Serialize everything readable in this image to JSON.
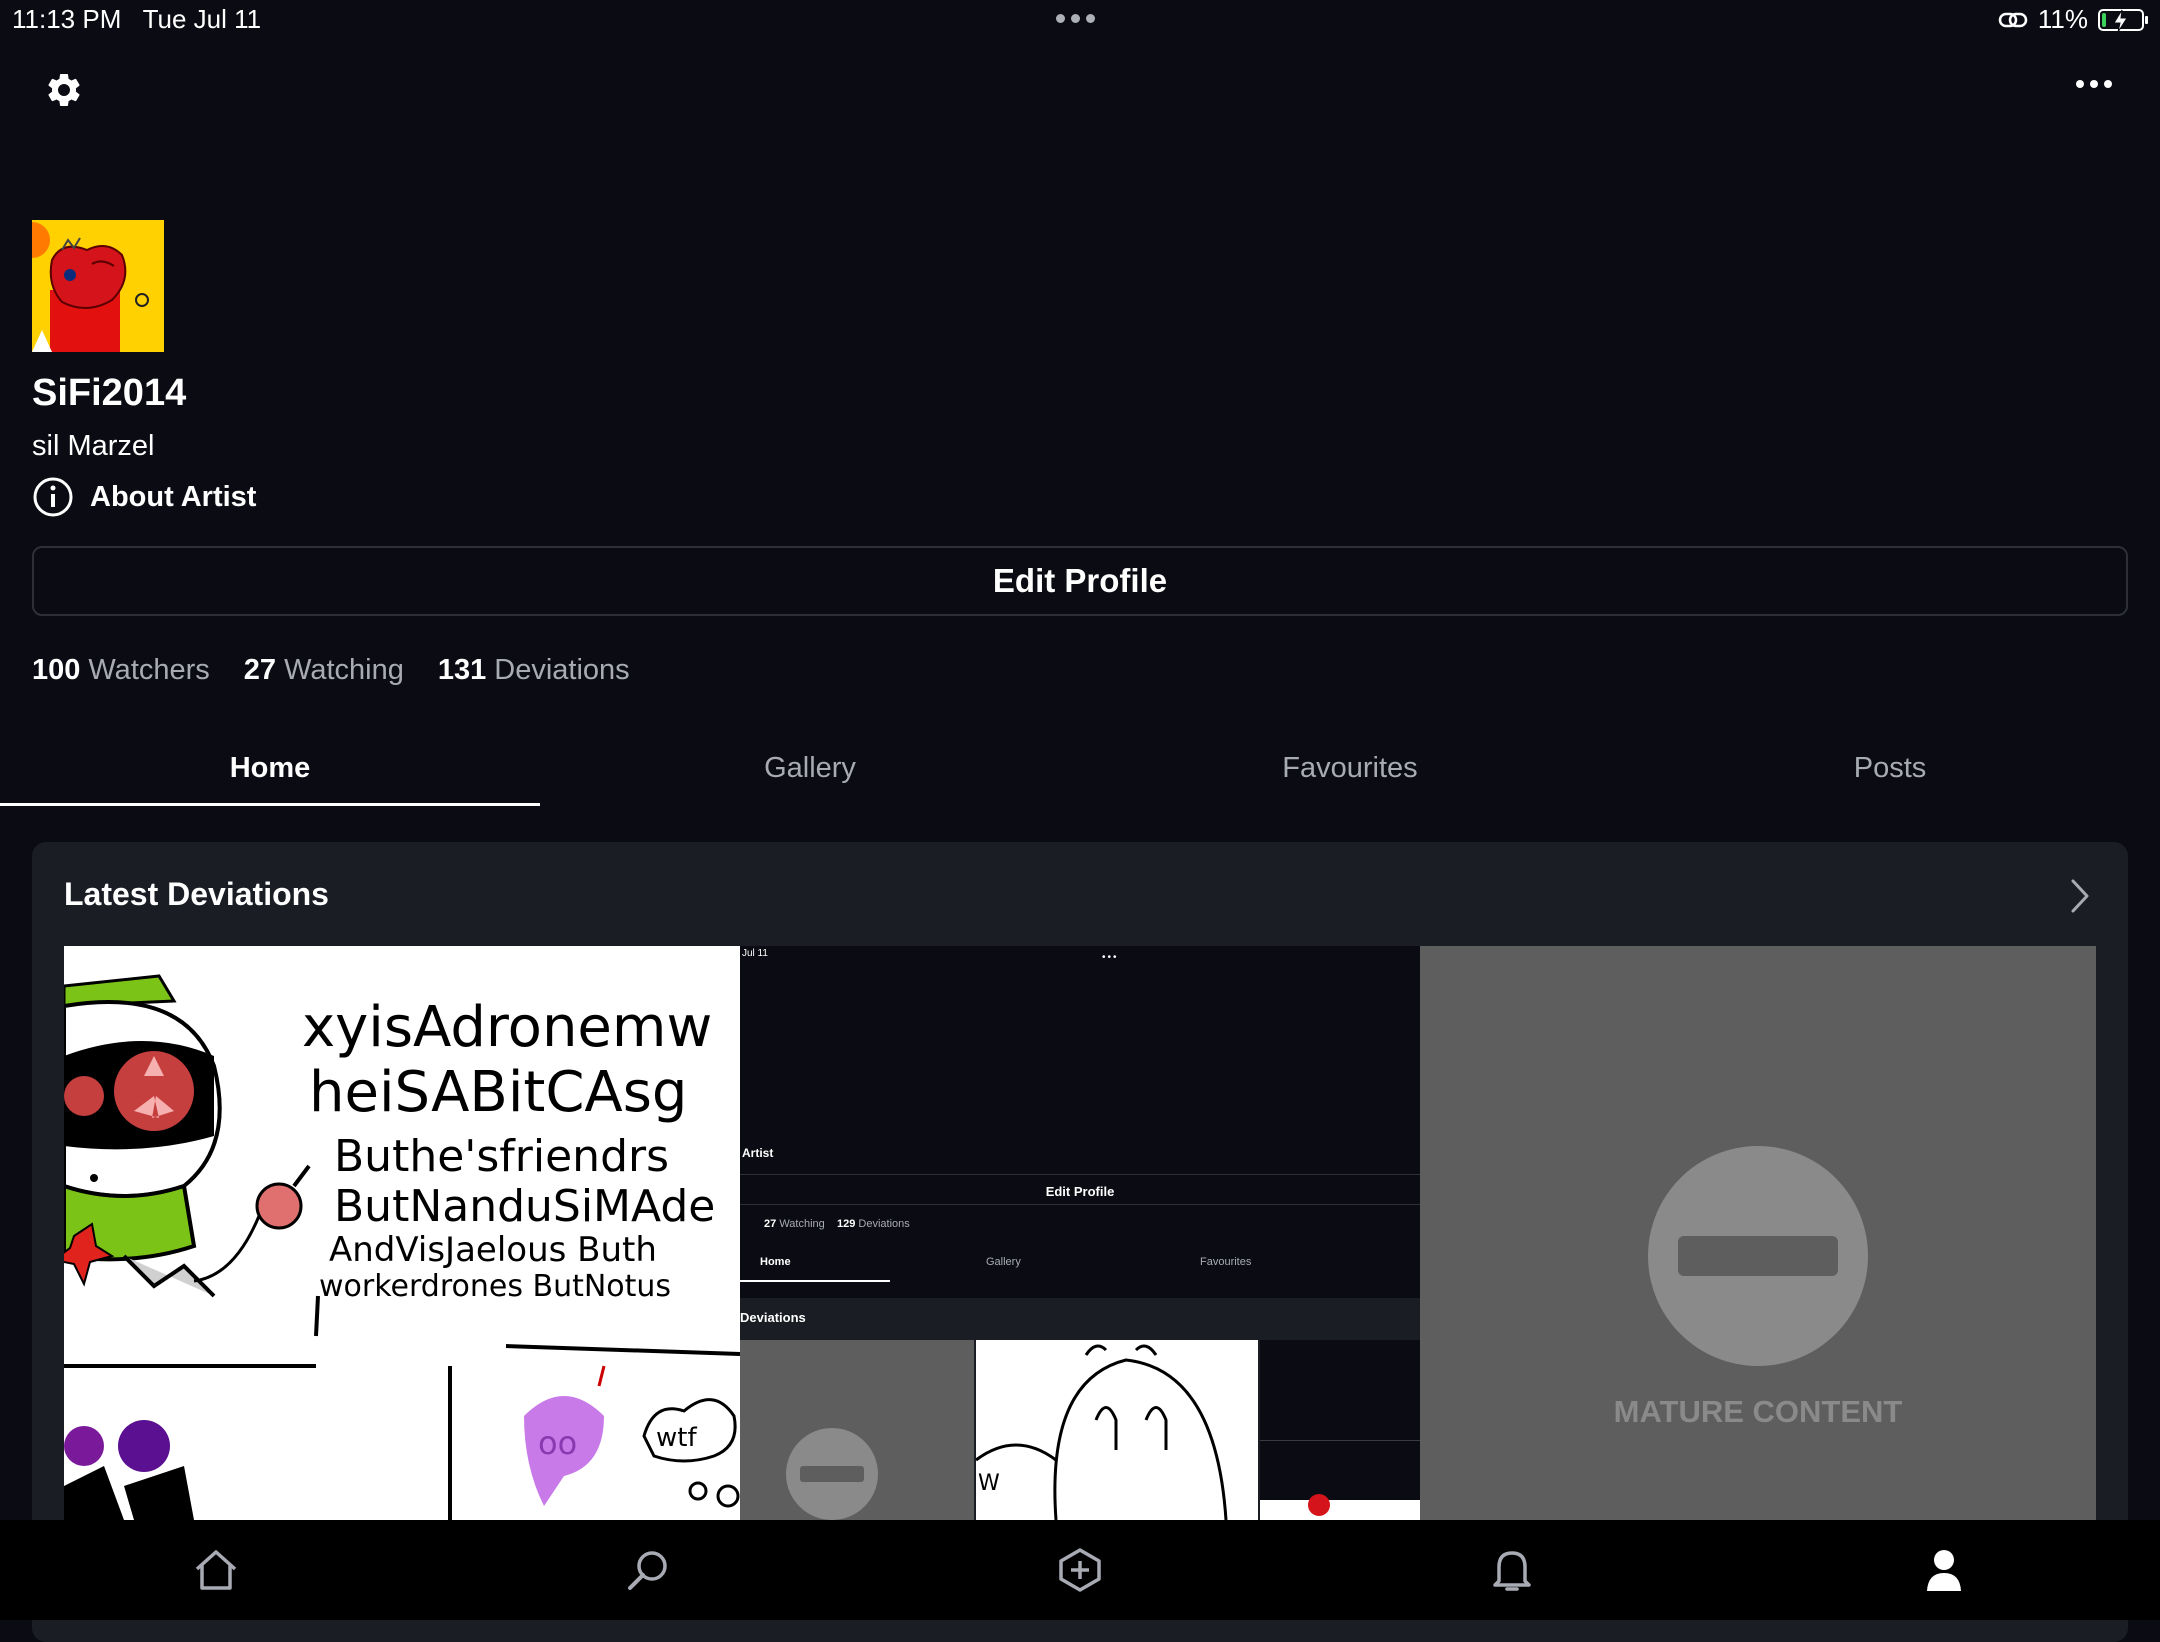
{
  "status_bar": {
    "time": "11:13 PM",
    "date": "Tue Jul 11",
    "battery": "11%",
    "battery_level_percent": 11,
    "icons": [
      "link-icon",
      "battery-charging-icon"
    ]
  },
  "header": {
    "settings_icon": "gear-icon",
    "more_icon": "more-horizontal-icon"
  },
  "profile": {
    "username": "SiFi2014",
    "real_name": "sil Marzel",
    "about_label": "About Artist",
    "edit_label": "Edit Profile"
  },
  "stats": [
    {
      "value": "100",
      "label": "Watchers"
    },
    {
      "value": "27",
      "label": "Watching"
    },
    {
      "value": "131",
      "label": "Deviations"
    }
  ],
  "tabs": [
    {
      "label": "Home",
      "active": true
    },
    {
      "label": "Gallery",
      "active": false
    },
    {
      "label": "Favourites",
      "active": false
    },
    {
      "label": "Posts",
      "active": false
    }
  ],
  "latest": {
    "title": "Latest Deviations",
    "thumb1": {
      "lines": [
        "xyisAdronemw",
        "heiSABitCAsg",
        "Buthe'sfriendrs",
        "ButNanduSiMAde",
        "AndVisJaelous Buth",
        "workerdrones ButNotus"
      ],
      "bubble_text": "oo",
      "cloud_text": "wtf"
    },
    "thumb2": {
      "date": "Jul 11",
      "artist": "Artist",
      "edit": "Edit Profile",
      "watching": "27",
      "watching_label": "Watching",
      "deviations": "129",
      "deviations_label": "Deviations",
      "tab_home": "Home",
      "tab_gallery": "Gallery",
      "tab_favourites": "Favourites",
      "section": "Deviations"
    },
    "thumb3": {
      "mature_label": "MATURE CONTENT"
    }
  },
  "bottom_nav": [
    "home-icon",
    "search-icon",
    "add-icon",
    "notifications-icon",
    "profile-icon"
  ],
  "colors": {
    "background": "#0b0c13",
    "card": "#1b1d25",
    "muted_text": "#a8abb4",
    "battery_green": "#3ad15d",
    "avatar_yellow": "#ffd100"
  }
}
